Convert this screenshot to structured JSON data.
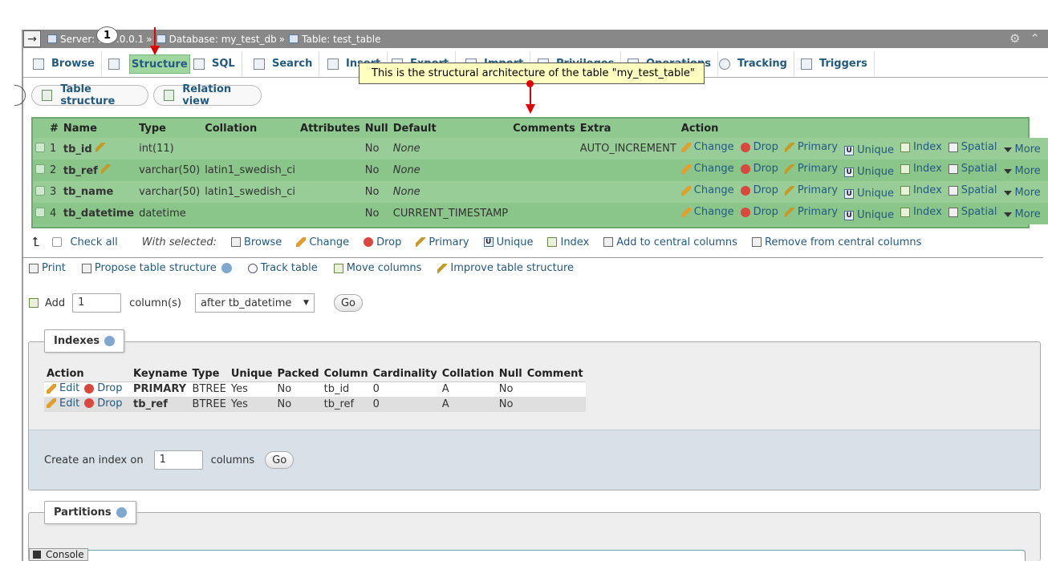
{
  "breadcrumb": {
    "server_label": "Server: 127.0.0.1",
    "sep": "»",
    "database_label": "Database: my_test_db",
    "table_label": "Table: test_table"
  },
  "marker": "1",
  "tabs": [
    "Browse",
    "Structure",
    "SQL",
    "Search",
    "Insert",
    "Export",
    "Import",
    "Privileges",
    "Operations",
    "Tracking",
    "Triggers"
  ],
  "tooltip": "This is the structural architecture of the table \"my_test_table\"",
  "subtabs": {
    "table_structure": "Table structure",
    "relation_view": "Relation view"
  },
  "columns_header": [
    "#",
    "Name",
    "Type",
    "Collation",
    "Attributes",
    "Null",
    "Default",
    "Comments",
    "Extra",
    "Action"
  ],
  "rows": [
    {
      "num": "1",
      "name": "tb_id",
      "type": "int(11)",
      "collation": "",
      "null": "No",
      "default": "None",
      "extra": "AUTO_INCREMENT"
    },
    {
      "num": "2",
      "name": "tb_ref",
      "type": "varchar(50)",
      "collation": "latin1_swedish_ci",
      "null": "No",
      "default": "None",
      "extra": ""
    },
    {
      "num": "3",
      "name": "tb_name",
      "type": "varchar(50)",
      "collation": "latin1_swedish_ci",
      "null": "No",
      "default": "None",
      "extra": ""
    },
    {
      "num": "4",
      "name": "tb_datetime",
      "type": "datetime",
      "collation": "",
      "null": "No",
      "default": "CURRENT_TIMESTAMP",
      "extra": ""
    }
  ],
  "row_actions": {
    "change": "Change",
    "drop": "Drop",
    "primary": "Primary",
    "unique": "Unique",
    "index": "Index",
    "spatial": "Spatial",
    "more": "More"
  },
  "with_selected": {
    "check_all": "Check all",
    "label": "With selected:",
    "browse": "Browse",
    "change": "Change",
    "drop": "Drop",
    "primary": "Primary",
    "unique": "Unique",
    "index": "Index",
    "add_central": "Add to central columns",
    "remove_central": "Remove from central columns"
  },
  "tools": {
    "print": "Print",
    "propose": "Propose table structure",
    "track": "Track table",
    "move": "Move columns",
    "improve": "Improve table structure"
  },
  "add_column": {
    "label": "Add",
    "count": "1",
    "unit": "column(s)",
    "position": "after tb_datetime",
    "go": "Go"
  },
  "indexes": {
    "title": "Indexes",
    "headers": [
      "Action",
      "Keyname",
      "Type",
      "Unique",
      "Packed",
      "Column",
      "Cardinality",
      "Collation",
      "Null",
      "Comment"
    ],
    "edit": "Edit",
    "drop": "Drop",
    "rows": [
      {
        "keyname": "PRIMARY",
        "type": "BTREE",
        "unique": "Yes",
        "packed": "No",
        "column": "tb_id",
        "cardinality": "0",
        "collation": "A",
        "null": "No",
        "comment": ""
      },
      {
        "keyname": "tb_ref",
        "type": "BTREE",
        "unique": "Yes",
        "packed": "No",
        "column": "tb_ref",
        "cardinality": "0",
        "collation": "A",
        "null": "No",
        "comment": ""
      }
    ],
    "create_label": "Create an index on",
    "create_count": "1",
    "create_unit": "columns",
    "go": "Go"
  },
  "partitions": {
    "title": "Partitions"
  },
  "console": "Console"
}
